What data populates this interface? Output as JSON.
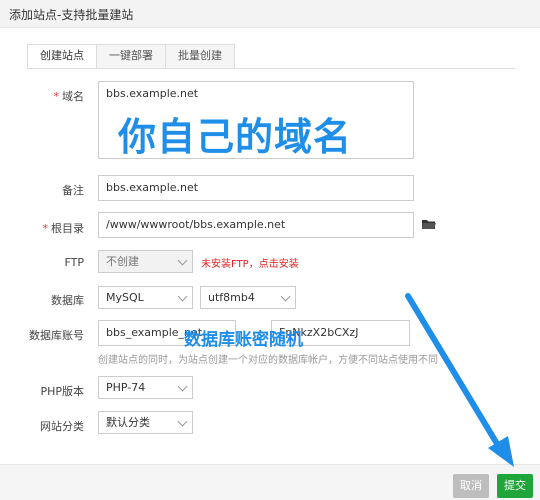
{
  "window": {
    "title": "添加站点-支持批量建站"
  },
  "tabs": [
    {
      "label": "创建站点",
      "active": true
    },
    {
      "label": "一键部署",
      "active": false
    },
    {
      "label": "批量创建",
      "active": false
    }
  ],
  "form": {
    "required_mark": "*",
    "domain": {
      "label": "域名",
      "value": "bbs.example.net"
    },
    "note": {
      "label": "备注",
      "value": "bbs.example.net"
    },
    "root": {
      "label": "根目录",
      "value": "/www/wwwroot/bbs.example.net"
    },
    "ftp": {
      "label": "FTP",
      "value": "不创建",
      "warning": "未安装FTP，点击安装"
    },
    "database": {
      "label": "数据库",
      "type": "MySQL",
      "charset": "utf8mb4"
    },
    "db_account": {
      "label": "数据库账号",
      "username": "bbs_example_net",
      "password": "FpNkzX2bCXzJ",
      "hint": "创建站点的同时，为站点创建一个对应的数据库帐户，方便不同站点使用不同数据库。"
    },
    "php": {
      "label": "PHP版本",
      "value": "PHP-74"
    },
    "category": {
      "label": "网站分类",
      "value": "默认分类"
    }
  },
  "annotations": {
    "domain_overlay": "你自己的域名",
    "db_overlay": "数据库账密随机",
    "arrow_color": "#1e8ee8"
  },
  "buttons": {
    "cancel": "取消",
    "submit": "提交"
  },
  "icons": {
    "folder": "folder-icon",
    "arrow": "arrow-annotation"
  },
  "colors": {
    "accent": "#20a53a",
    "warning": "#e02020",
    "annotation": "#1e8ee8"
  }
}
